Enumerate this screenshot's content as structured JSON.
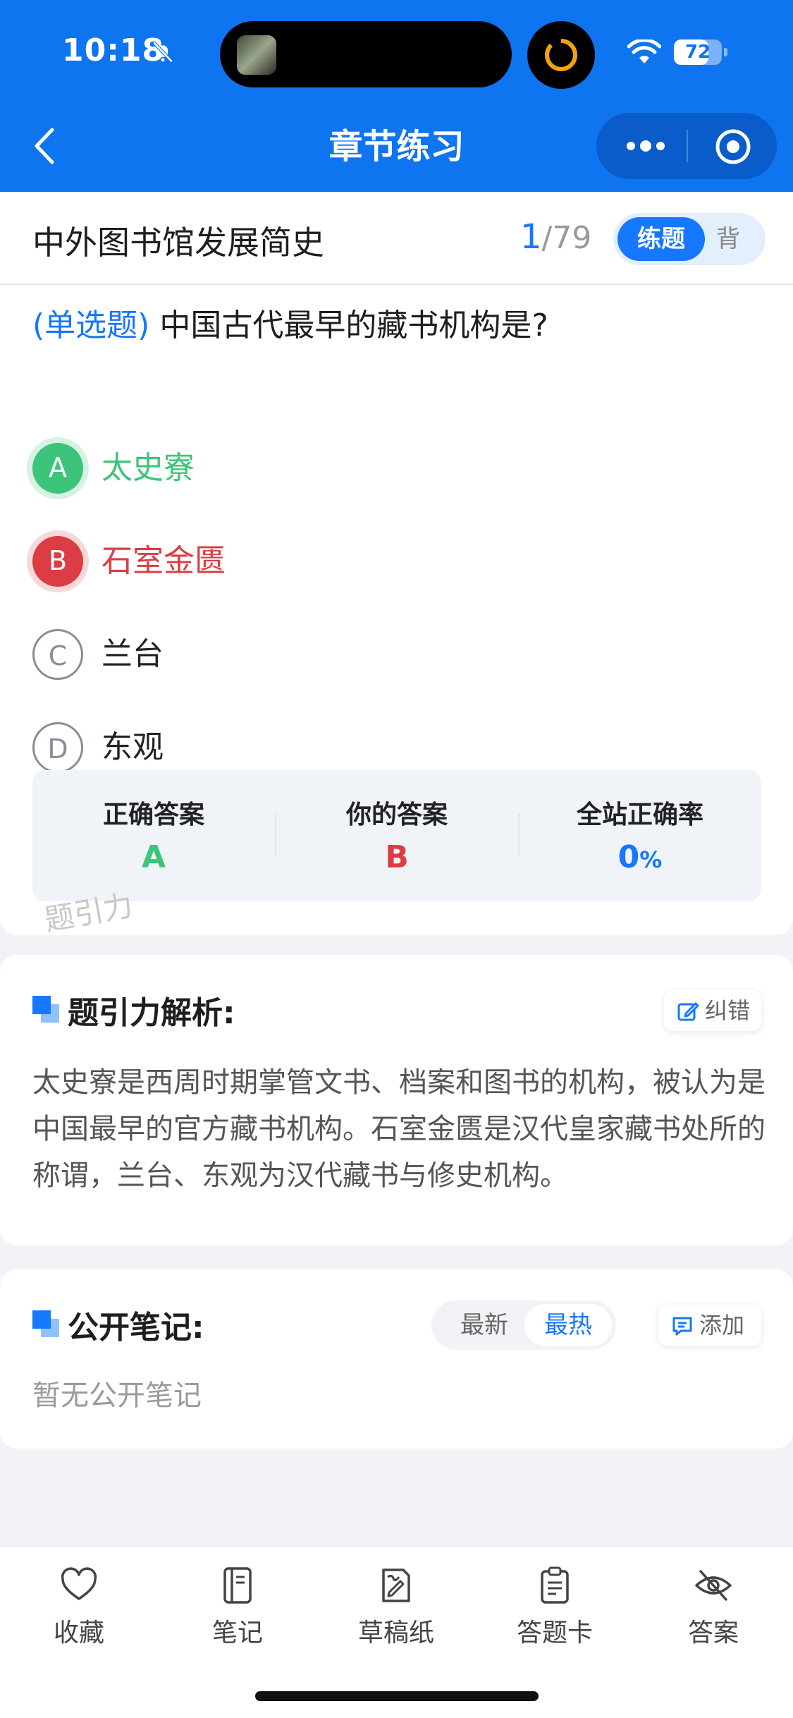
{
  "status_bar": {
    "time": "10:18",
    "battery": "72",
    "battery_level": 0.72
  },
  "nav": {
    "title": "章节练习"
  },
  "chapter_row": {
    "chapter_title": "中外图书馆发展简史",
    "progress_current": "1",
    "progress_total": "/79",
    "mode_active": "练题",
    "mode_other": "背"
  },
  "question": {
    "type": "(单选题)",
    "text": "中国古代最早的藏书机构是?",
    "options": [
      {
        "letter": "A",
        "text": "太史寮",
        "state": "correct"
      },
      {
        "letter": "B",
        "text": "石室金匮",
        "state": "wrong"
      },
      {
        "letter": "C",
        "text": "兰台",
        "state": "normal"
      },
      {
        "letter": "D",
        "text": "东观",
        "state": "normal"
      }
    ]
  },
  "answer_summary": {
    "correct_label": "正确答案",
    "correct_value": "A",
    "yours_label": "你的答案",
    "yours_value": "B",
    "rate_label": "全站正确率",
    "rate_value": "0",
    "rate_unit": "%"
  },
  "watermark": "题引力",
  "analysis": {
    "title": "题引力解析:",
    "correct_label": "纠错",
    "text": "太史寮是西周时期掌管文书、档案和图书的机构，被认为是中国最早的官方藏书机构。石室金匮是汉代皇家藏书处所的称谓，兰台、东观为汉代藏书与修史机构。"
  },
  "notes": {
    "title": "公开笔记:",
    "sort_newest": "最新",
    "sort_hot": "最热",
    "sort_selected": "最热",
    "add_label": "添加",
    "empty_text": "暂无公开笔记"
  },
  "bottom_bar": [
    {
      "label": "收藏",
      "icon": "heart-icon"
    },
    {
      "label": "笔记",
      "icon": "notebook-icon"
    },
    {
      "label": "草稿纸",
      "icon": "draft-paper-icon"
    },
    {
      "label": "答题卡",
      "icon": "answer-sheet-icon"
    },
    {
      "label": "答案",
      "icon": "eye-off-icon"
    }
  ],
  "colors": {
    "brand": "#0f74ef",
    "accent": "#1677ff",
    "correct": "#3cc57a",
    "wrong": "#dc3d44"
  }
}
